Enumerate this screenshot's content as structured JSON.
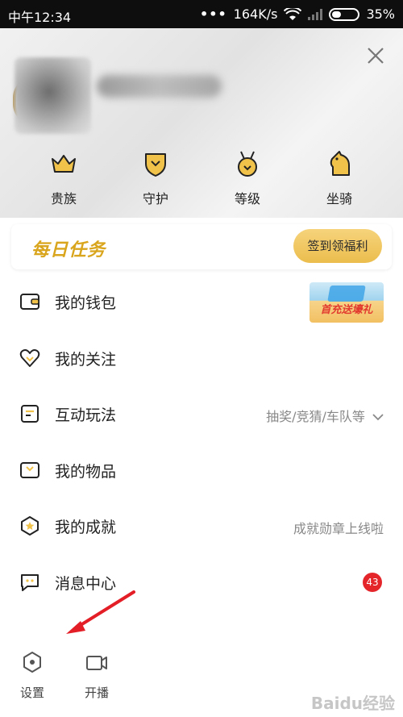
{
  "statusbar": {
    "time": "中午12:34",
    "dots": "•••",
    "speed": "164K/s",
    "battery": "35%"
  },
  "perks": [
    {
      "label": "贵族",
      "icon": "crown-icon"
    },
    {
      "label": "守护",
      "icon": "shield-icon"
    },
    {
      "label": "等级",
      "icon": "medal-icon"
    },
    {
      "label": "坐骑",
      "icon": "horse-icon"
    }
  ],
  "daily_task": {
    "title": "每日任务",
    "button": "签到领福利"
  },
  "menu": [
    {
      "label": "我的钱包",
      "icon": "wallet-icon",
      "promo": "首充送壕礼"
    },
    {
      "label": "我的关注",
      "icon": "heart-icon"
    },
    {
      "label": "互动玩法",
      "icon": "note-icon",
      "hint": "抽奖/竞猜/车队等"
    },
    {
      "label": "我的物品",
      "icon": "box-icon"
    },
    {
      "label": "我的成就",
      "icon": "achievement-icon",
      "hint": "成就勋章上线啦"
    },
    {
      "label": "消息中心",
      "icon": "message-icon",
      "badge": "43"
    }
  ],
  "bottom": {
    "settings": "设置",
    "broadcast": "开播"
  },
  "watermark": "Baidu经验",
  "colors": {
    "accent": "#e8b84a",
    "badge": "#e4262b",
    "arrow": "#e41e26"
  }
}
